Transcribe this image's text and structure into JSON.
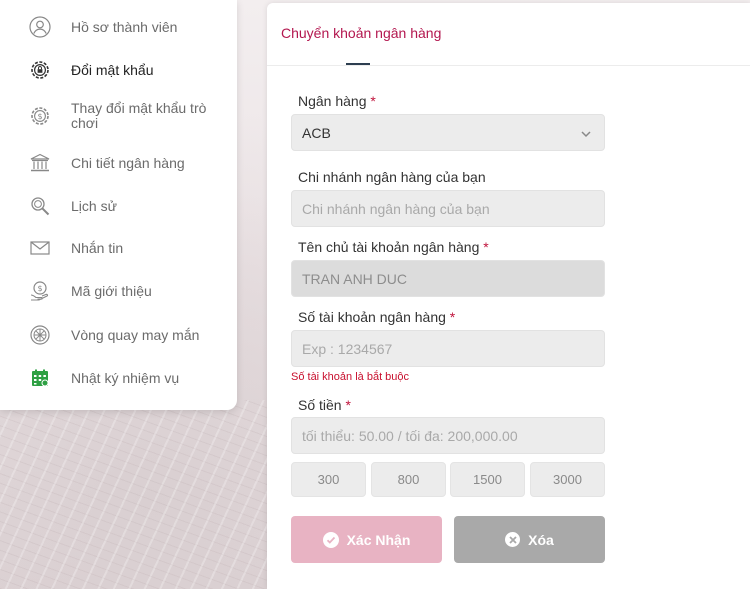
{
  "sidebar": {
    "items": [
      {
        "label": "Hồ sơ thành viên",
        "icon": "user-icon"
      },
      {
        "label": "Đổi mật khẩu",
        "icon": "lock-gear-icon",
        "active": true
      },
      {
        "label": "Thay đổi mật khẩu trò chơi",
        "icon": "dollar-gear-icon"
      },
      {
        "label": "Chi tiết ngân hàng",
        "icon": "bank-icon"
      },
      {
        "label": "Lịch sử",
        "icon": "search-history-icon"
      },
      {
        "label": "Nhắn tin",
        "icon": "envelope-icon"
      },
      {
        "label": "Mã giới thiệu",
        "icon": "referral-icon"
      },
      {
        "label": "Vòng quay may mắn",
        "icon": "wheel-icon"
      },
      {
        "label": "Nhật ký nhiệm vụ",
        "icon": "calendar-icon"
      }
    ]
  },
  "tab": {
    "title": "Chuyển khoản ngân hàng"
  },
  "form": {
    "bank_label": "Ngân hàng",
    "bank_value": "ACB",
    "branch_label": "Chi nhánh ngân hàng của bạn",
    "branch_placeholder": "Chi nhánh ngân hàng của bạn",
    "holder_label": "Tên chủ tài khoản ngân hàng",
    "holder_value": "TRAN ANH DUC",
    "account_label": "Số tài khoản ngân hàng",
    "account_placeholder": "Exp : 1234567",
    "account_error": "Số tài khoản là bắt buộc",
    "amount_label": "Số tiền",
    "amount_placeholder": "tối thiểu: 50.00 / tối đa: 200,000.00",
    "required_mark": "*",
    "quick_amounts": [
      "300",
      "800",
      "1500",
      "3000"
    ],
    "confirm_label": "Xác Nhận",
    "clear_label": "Xóa"
  },
  "colors": {
    "accent": "#b3174f",
    "confirm_button": "#e8b3c3",
    "clear_button": "#a9a9a9",
    "error": "#c8102e",
    "calendar_icon": "#2ea043"
  }
}
